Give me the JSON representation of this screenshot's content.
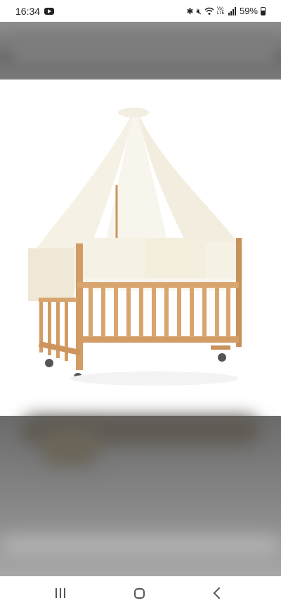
{
  "status_bar": {
    "time": "16:34",
    "battery_percent": "59%",
    "icons": [
      "youtube-icon",
      "bluetooth-icon",
      "mute-icon",
      "wifi-icon",
      "volte-icon",
      "signal-icon",
      "battery-icon"
    ],
    "volte_label": "Vo) LTE"
  },
  "image": {
    "subject": "crib-with-canopy"
  },
  "nav_bar": {
    "buttons": [
      "recent-apps",
      "home",
      "back"
    ]
  }
}
